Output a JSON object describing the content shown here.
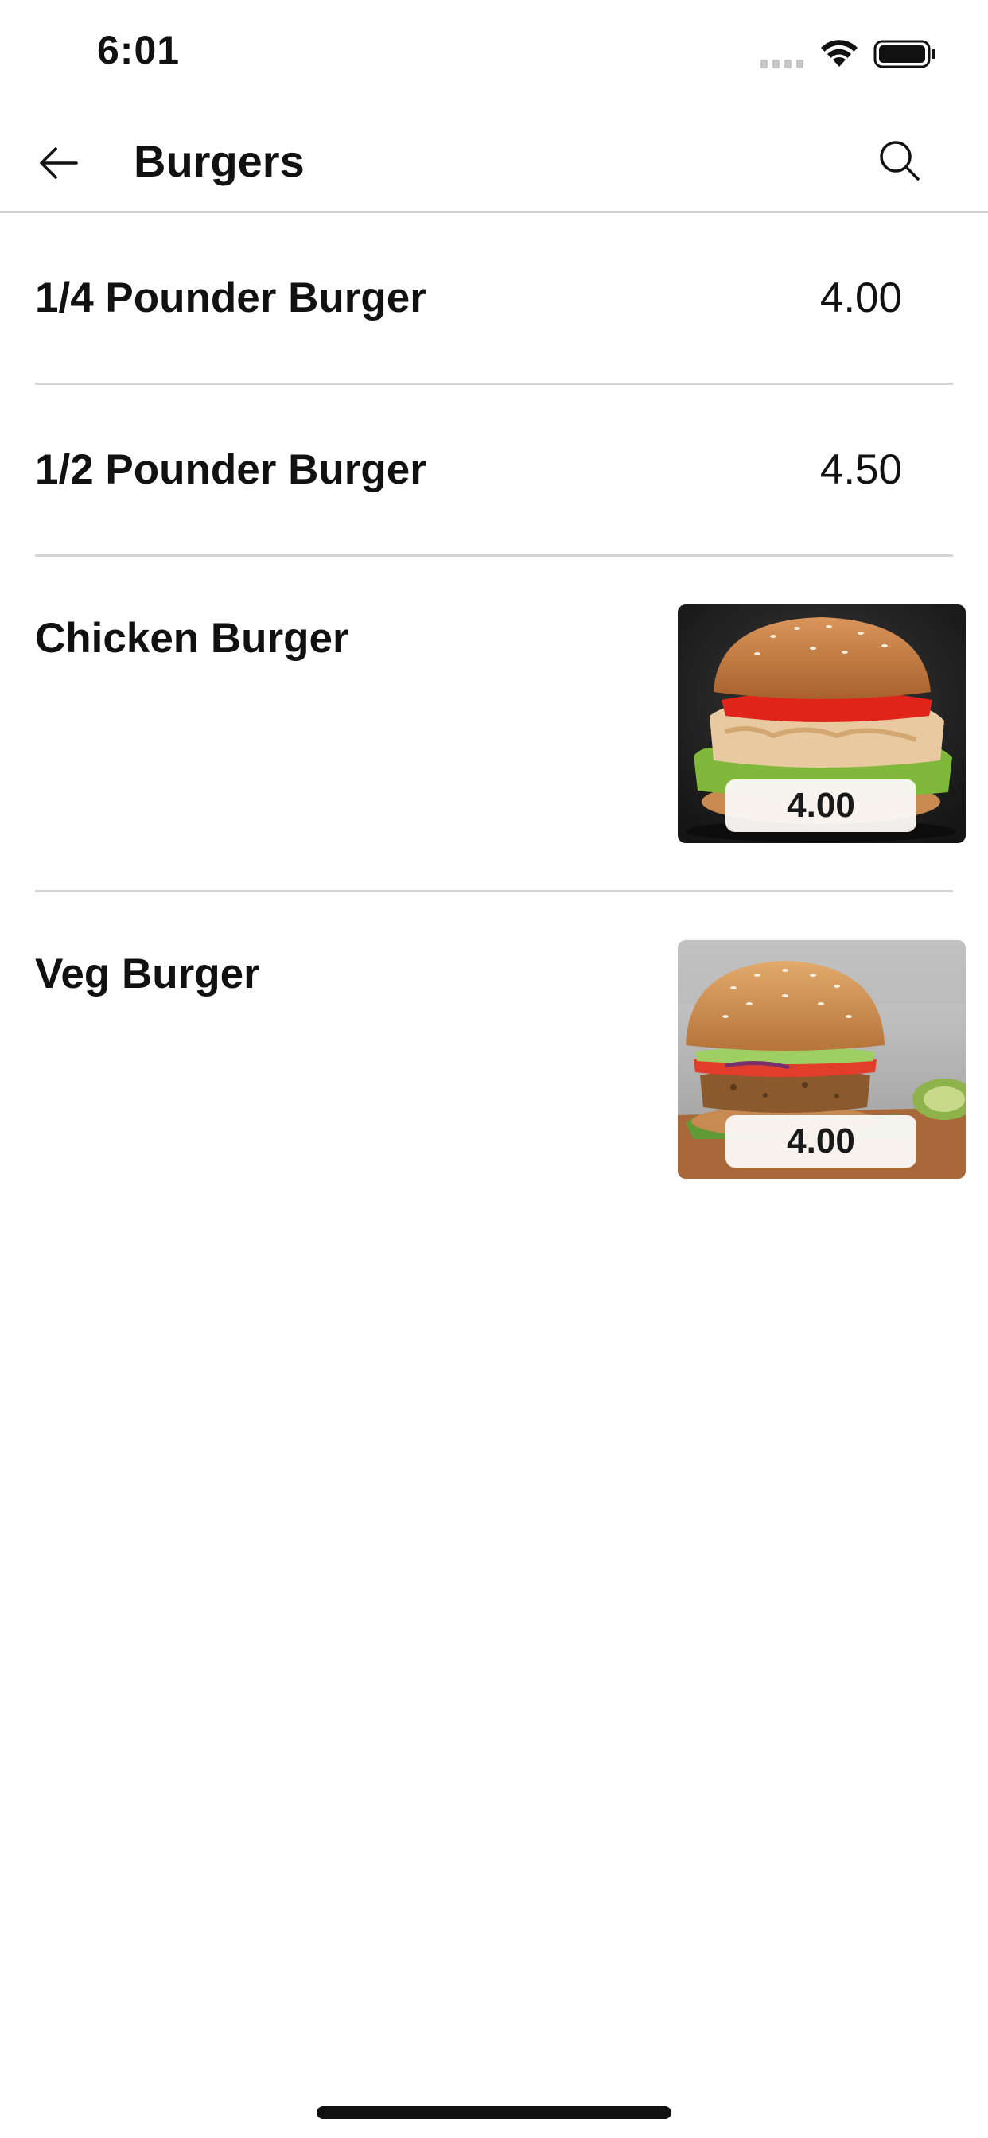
{
  "status_bar": {
    "time": "6:01"
  },
  "header": {
    "title": "Burgers",
    "back_icon": "arrow-left-icon",
    "search_icon": "search-icon"
  },
  "menu": {
    "items": [
      {
        "name": "1/4 Pounder Burger",
        "price": "4.00",
        "has_image": false
      },
      {
        "name": "1/2 Pounder Burger",
        "price": "4.50",
        "has_image": false
      },
      {
        "name": "Chicken Burger",
        "price": "4.00",
        "has_image": true,
        "image": "chicken-burger-photo"
      },
      {
        "name": "Veg Burger",
        "price": "4.00",
        "has_image": true,
        "image": "veg-burger-photo"
      }
    ]
  },
  "colors": {
    "text": "#111111",
    "divider": "#d5d5d5",
    "background": "#ffffff"
  }
}
